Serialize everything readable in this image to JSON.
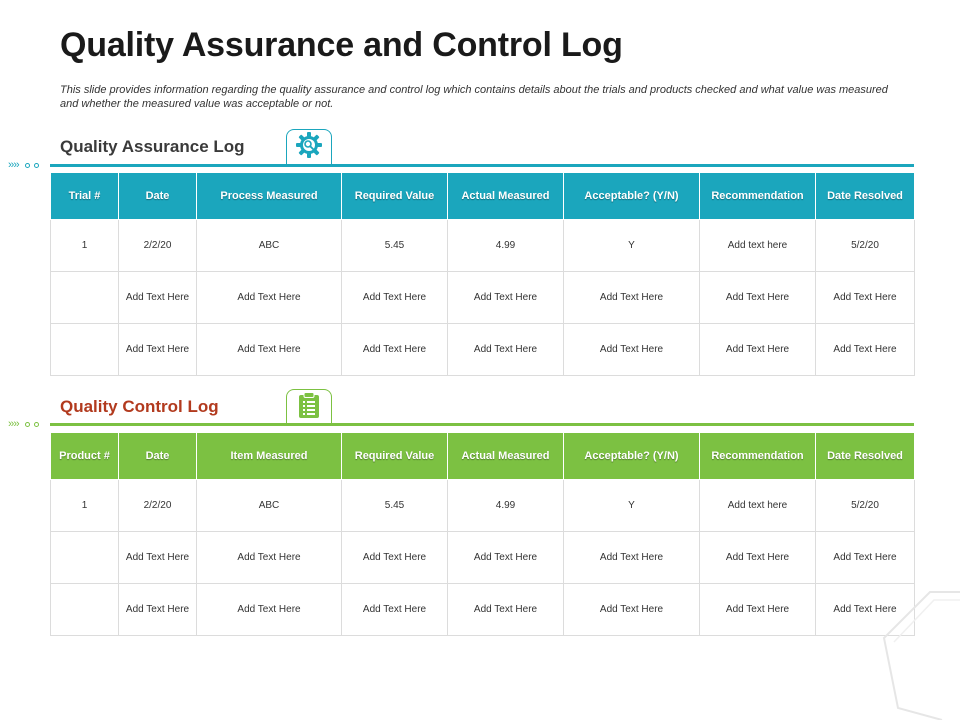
{
  "page": {
    "title": "Quality Assurance and Control Log",
    "subtitle": "This slide provides information regarding the quality assurance and control log which contains details about the trials and products checked and what value was measured and whether the measured value was acceptable or not."
  },
  "colors": {
    "assurance_accent": "#1ba6bd",
    "control_accent": "#7cc142",
    "control_heading": "#b23a1e"
  },
  "assurance": {
    "heading": "Quality Assurance Log",
    "icon": "gear-magnifier-icon",
    "columns": [
      "Trial #",
      "Date",
      "Process Measured",
      "Required Value",
      "Actual Measured",
      "Acceptable? (Y/N)",
      "Recommendation",
      "Date Resolved"
    ],
    "rows": [
      [
        "1",
        "2/2/20",
        "ABC",
        "5.45",
        "4.99",
        "Y",
        "Add text here",
        "5/2/20"
      ],
      [
        "",
        "Add Text Here",
        "Add Text Here",
        "Add Text Here",
        "Add Text Here",
        "Add Text Here",
        "Add Text Here",
        "Add Text Here"
      ],
      [
        "",
        "Add Text Here",
        "Add Text Here",
        "Add Text Here",
        "Add Text Here",
        "Add Text Here",
        "Add Text Here",
        "Add Text Here"
      ]
    ]
  },
  "control": {
    "heading": "Quality Control Log",
    "icon": "clipboard-icon",
    "columns": [
      "Product #",
      "Date",
      "Item Measured",
      "Required Value",
      "Actual Measured",
      "Acceptable? (Y/N)",
      "Recommendation",
      "Date Resolved"
    ],
    "rows": [
      [
        "1",
        "2/2/20",
        "ABC",
        "5.45",
        "4.99",
        "Y",
        "Add text here",
        "5/2/20"
      ],
      [
        "",
        "Add Text Here",
        "Add Text Here",
        "Add Text Here",
        "Add Text Here",
        "Add Text Here",
        "Add Text Here",
        "Add Text Here"
      ],
      [
        "",
        "Add Text Here",
        "Add Text Here",
        "Add Text Here",
        "Add Text Here",
        "Add Text Here",
        "Add Text Here",
        "Add Text Here"
      ]
    ]
  }
}
